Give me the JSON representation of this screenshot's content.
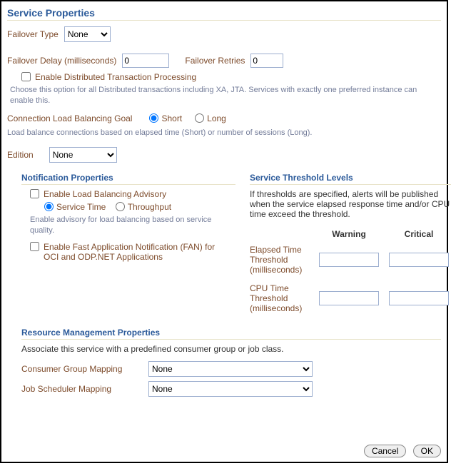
{
  "title": "Service Properties",
  "failover": {
    "type_label": "Failover Type",
    "type_value": "None",
    "delay_label": "Failover Delay (milliseconds)",
    "delay_value": "0",
    "retries_label": "Failover Retries",
    "retries_value": "0"
  },
  "dtp": {
    "checkbox_label": "Enable Distributed Transaction Processing",
    "help": "Choose this option for all Distributed transactions including XA, JTA. Services with exactly one preferred instance can enable this."
  },
  "clb": {
    "label": "Connection Load Balancing Goal",
    "short_label": "Short",
    "long_label": "Long",
    "help": "Load balance connections based on elapsed time (Short) or number of sessions (Long)."
  },
  "edition": {
    "label": "Edition",
    "value": "None"
  },
  "notification": {
    "heading": "Notification Properties",
    "lba_label": "Enable Load Balancing Advisory",
    "service_time_label": "Service Time",
    "throughput_label": "Throughput",
    "lba_help": "Enable advisory for load balancing based on service quality.",
    "fan_label": "Enable Fast Application Notification (FAN) for OCI and ODP.NET Applications"
  },
  "thresholds": {
    "heading": "Service Threshold Levels",
    "help": "If thresholds are specified, alerts will be published when the service elapsed response time and/or CPU time exceed the threshold.",
    "warning_col": "Warning",
    "critical_col": "Critical",
    "elapsed_label": "Elapsed Time Threshold (milliseconds)",
    "cpu_label": "CPU Time Threshold (milliseconds)",
    "elapsed_warning": "",
    "elapsed_critical": "",
    "cpu_warning": "",
    "cpu_critical": ""
  },
  "rmp": {
    "heading": "Resource Management Properties",
    "desc": "Associate this service with a predefined consumer group or job class.",
    "cgm_label": "Consumer Group Mapping",
    "cgm_value": "None",
    "jsm_label": "Job Scheduler Mapping",
    "jsm_value": "None"
  },
  "buttons": {
    "cancel": "Cancel",
    "ok": "OK"
  }
}
